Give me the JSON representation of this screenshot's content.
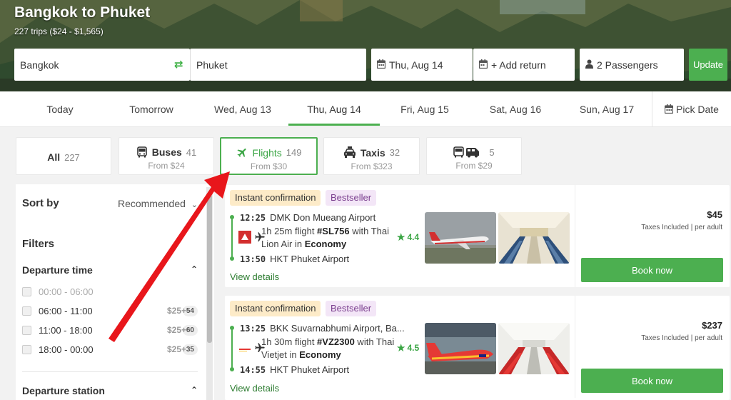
{
  "hero": {
    "title": "Bangkok to Phuket",
    "subtitle": "227 trips ($24 - $1,565)"
  },
  "search": {
    "from": "Bangkok",
    "to": "Phuket",
    "date": "Thu, Aug 14",
    "return": "+ Add return",
    "passengers": "2 Passengers",
    "update_label": "Update"
  },
  "date_tabs": [
    {
      "label": "Today"
    },
    {
      "label": "Tomorrow"
    },
    {
      "label": "Wed, Aug 13"
    },
    {
      "label": "Thu, Aug 14",
      "active": true
    },
    {
      "label": "Fri, Aug 15"
    },
    {
      "label": "Sat, Aug 16"
    },
    {
      "label": "Sun, Aug 17"
    }
  ],
  "pick_date_label": "Pick Date",
  "modes": [
    {
      "label": "All",
      "count": "227",
      "from": ""
    },
    {
      "label": "Buses",
      "count": "41",
      "from": "From $24",
      "icon": "bus-icon"
    },
    {
      "label": "Flights",
      "count": "149",
      "from": "From $30",
      "icon": "plane-icon",
      "active": true
    },
    {
      "label": "Taxis",
      "count": "32",
      "from": "From $323",
      "icon": "taxi-icon"
    },
    {
      "label": "",
      "count": "5",
      "from": "From $29",
      "icon": "bus-van-icon"
    }
  ],
  "sidebar": {
    "sort_label": "Sort by",
    "sort_value": "Recommended",
    "filters_label": "Filters",
    "departure_time_label": "Departure time",
    "departure_options": [
      {
        "label": "00:00 - 06:00",
        "price": "",
        "count": "",
        "disabled": true
      },
      {
        "label": "06:00 - 11:00",
        "price": "$25+",
        "count": "54"
      },
      {
        "label": "11:00 - 18:00",
        "price": "$25+",
        "count": "60"
      },
      {
        "label": "18:00 - 00:00",
        "price": "$25+",
        "count": "35"
      }
    ],
    "departure_station_label": "Departure station"
  },
  "results": [
    {
      "tags": {
        "confirmation": "Instant confirmation",
        "best": "Bestseller"
      },
      "dep_time": "12:25",
      "dep_station": "DMK Don Mueang Airport",
      "desc_pre": "1h 25m flight ",
      "flight_no": "#SL756",
      "desc_mid": " with Thai Lion Air in ",
      "cabin": "Economy",
      "rating": "4.4",
      "arr_time": "13:50",
      "arr_station": "HKT Phuket Airport",
      "view_details": "View details",
      "price": "$45",
      "taxes": "Taxes Included | per adult",
      "book": "Book now",
      "airline_color": "#d32f2f"
    },
    {
      "tags": {
        "confirmation": "Instant confirmation",
        "best": "Bestseller"
      },
      "dep_time": "13:25",
      "dep_station": "BKK Suvarnabhumi Airport, Ba...",
      "desc_pre": "1h 30m flight ",
      "flight_no": "#VZ2300",
      "desc_mid": " with Thai Vietjet in ",
      "cabin": "Economy",
      "rating": "4.5",
      "arr_time": "14:55",
      "arr_station": "HKT Phuket Airport",
      "view_details": "View details",
      "price": "$237",
      "taxes": "Taxes Included | per adult",
      "book": "Book now",
      "airline_color": "#e53935"
    }
  ],
  "colors": {
    "accent": "#4caf50",
    "arrow": "#e8161b"
  }
}
